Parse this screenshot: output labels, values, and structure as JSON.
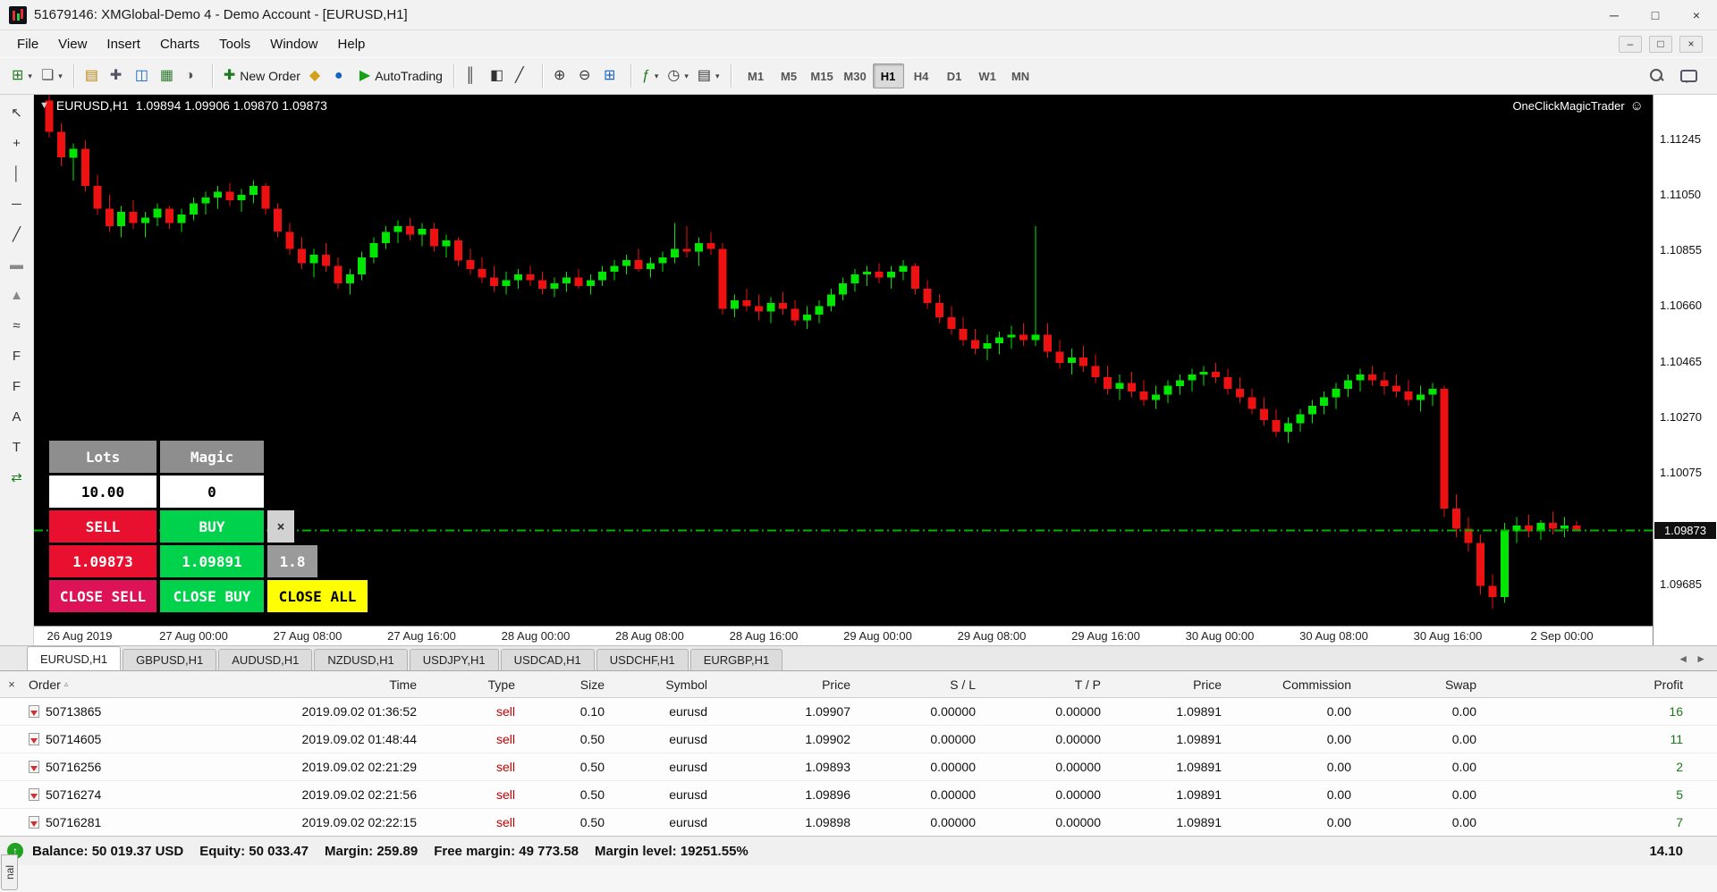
{
  "window": {
    "title": "51679146: XMGlobal-Demo 4 - Demo Account - [EURUSD,H1]",
    "controls": {
      "minimize": "─",
      "restore": "□",
      "close": "×"
    }
  },
  "menu": {
    "items": [
      "File",
      "View",
      "Insert",
      "Charts",
      "Tools",
      "Window",
      "Help"
    ],
    "mdi_controls": {
      "minimize": "–",
      "restore": "□",
      "close": "×"
    }
  },
  "toolbar": {
    "groups": [
      {
        "buttons": [
          {
            "name": "new-chart",
            "glyph": "⊞",
            "color": "#1b7a1b",
            "caret": true
          },
          {
            "name": "profiles",
            "glyph": "❏",
            "color": "#555",
            "caret": true
          }
        ]
      },
      {
        "buttons": [
          {
            "name": "market-watch",
            "glyph": "▤",
            "color": "#b8860b"
          },
          {
            "name": "data-window",
            "glyph": "✚",
            "color": "#556"
          },
          {
            "name": "navigator",
            "glyph": "◫",
            "color": "#1565c0"
          },
          {
            "name": "terminal-toggle",
            "glyph": "▦",
            "color": "#2e7d32"
          },
          {
            "name": "strategy-tester",
            "glyph": "◑",
            "color": "#555"
          }
        ]
      },
      {
        "buttons": [
          {
            "name": "new-order",
            "glyph": "✚",
            "color": "#1b7a1b",
            "label": "New Order"
          },
          {
            "name": "metaeditor",
            "glyph": "◆",
            "color": "#d4a017"
          },
          {
            "name": "mql5-community",
            "glyph": "●",
            "color": "#1565c0"
          },
          {
            "name": "autotrading",
            "glyph": "▶",
            "color": "#18a018",
            "label": "AutoTrading"
          }
        ]
      },
      {
        "buttons": [
          {
            "name": "bar-chart-mode",
            "glyph": "║",
            "color": "#333"
          },
          {
            "name": "candlestick-mode",
            "glyph": "◧",
            "color": "#333"
          },
          {
            "name": "line-chart-mode",
            "glyph": "╱",
            "color": "#333"
          }
        ]
      },
      {
        "buttons": [
          {
            "name": "zoom-in",
            "glyph": "⊕",
            "color": "#333"
          },
          {
            "name": "zoom-out",
            "glyph": "⊖",
            "color": "#333"
          },
          {
            "name": "tile-windows",
            "glyph": "⊞",
            "color": "#1565c0"
          }
        ]
      },
      {
        "buttons": [
          {
            "name": "indicators",
            "glyph": "ƒ",
            "color": "#1b7a1b",
            "caret": true
          },
          {
            "name": "periods",
            "glyph": "◷",
            "color": "#333",
            "caret": true
          },
          {
            "name": "templates",
            "glyph": "▤",
            "color": "#333",
            "caret": true
          }
        ]
      }
    ],
    "timeframes": [
      "M1",
      "M5",
      "M15",
      "M30",
      "H1",
      "H4",
      "D1",
      "W1",
      "MN"
    ],
    "active_timeframe": "H1"
  },
  "left_tools": [
    {
      "name": "cursor-tool",
      "glyph": "↖"
    },
    {
      "name": "crosshair-tool",
      "glyph": "+"
    },
    {
      "name": "vertical-line-tool",
      "glyph": "│"
    },
    {
      "name": "horizontal-line-tool",
      "glyph": "─"
    },
    {
      "name": "trendline-tool",
      "glyph": "╱"
    },
    {
      "name": "rectangle-tool",
      "glyph": "▬",
      "color": "#8a8a8a"
    },
    {
      "name": "triangle-tool",
      "glyph": "▲",
      "color": "#8a8a8a"
    },
    {
      "name": "fibonacci-tool",
      "glyph": "≈"
    },
    {
      "name": "channel-tool",
      "glyph": "F"
    },
    {
      "name": "fibo-expansion-tool",
      "glyph": "F"
    },
    {
      "name": "text-tool",
      "glyph": "A"
    },
    {
      "name": "label-tool",
      "glyph": "T"
    },
    {
      "name": "arrows-tool",
      "glyph": "⇄",
      "color": "#1b7a1b"
    }
  ],
  "chart": {
    "oneclick_toggle": "▼",
    "symbol_label": "EURUSD,H1",
    "ohlc_line": "1.09894 1.09906 1.09870 1.09873",
    "overlay_label": "OneClickMagicTrader",
    "overlay_smiley": "☺",
    "price_scale": [
      "1.11245",
      "1.11050",
      "1.10855",
      "1.10660",
      "1.10465",
      "1.10270",
      "1.10075",
      "1.09685"
    ],
    "current_price": "1.09873",
    "time_labels": [
      "26 Aug 2019",
      "27 Aug 00:00",
      "27 Aug 08:00",
      "27 Aug 16:00",
      "28 Aug 00:00",
      "28 Aug 08:00",
      "28 Aug 16:00",
      "29 Aug 00:00",
      "29 Aug 08:00",
      "29 Aug 16:00",
      "30 Aug 00:00",
      "30 Aug 08:00",
      "30 Aug 16:00",
      "2 Sep 00:00"
    ]
  },
  "colors": {
    "bull": "#00e600",
    "bear": "#ee1111",
    "price_line": "#00b400",
    "badge_bg": "#101010",
    "panel_header_gray": "#8e8e8e",
    "panel_red": "#e8102e",
    "panel_green": "#00d24b",
    "panel_crimson": "#de1256",
    "panel_yellow": "#ffff00",
    "panel_gray": "#9a9a9a",
    "profit_green": "#1a7a1a",
    "sell_red": "#c00000"
  },
  "trade_panel": {
    "lots_label": "Lots",
    "magic_label": "Magic",
    "lots_value": "10.00",
    "magic_value": "0",
    "sell_label": "SELL",
    "buy_label": "BUY",
    "close_x": "×",
    "sell_price": "1.09873",
    "buy_price": "1.09891",
    "spread": "1.8",
    "close_sell_label": "CLOSE SELL",
    "close_buy_label": "CLOSE BUY",
    "close_all_label": "CLOSE ALL"
  },
  "chart_data": {
    "type": "candlestick",
    "symbol": "EURUSD",
    "timeframe": "H1",
    "ylim": [
      1.0954,
      1.114
    ],
    "current_price": 1.09873,
    "ohlc": [
      [
        1.1138,
        1.114,
        1.1125,
        1.1127
      ],
      [
        1.1127,
        1.113,
        1.1115,
        1.1118
      ],
      [
        1.1118,
        1.1123,
        1.111,
        1.1121
      ],
      [
        1.1121,
        1.1124,
        1.1106,
        1.1108
      ],
      [
        1.1108,
        1.1112,
        1.1098,
        1.11
      ],
      [
        1.11,
        1.1105,
        1.1092,
        1.1094
      ],
      [
        1.1094,
        1.1101,
        1.109,
        1.1099
      ],
      [
        1.1099,
        1.1103,
        1.1093,
        1.1095
      ],
      [
        1.1095,
        1.1099,
        1.109,
        1.1097
      ],
      [
        1.1097,
        1.1102,
        1.1094,
        1.11
      ],
      [
        1.11,
        1.1101,
        1.1093,
        1.1095
      ],
      [
        1.1095,
        1.11,
        1.1092,
        1.1098
      ],
      [
        1.1098,
        1.1104,
        1.1096,
        1.1102
      ],
      [
        1.1102,
        1.1106,
        1.1098,
        1.1104
      ],
      [
        1.1104,
        1.1108,
        1.11,
        1.1106
      ],
      [
        1.1106,
        1.1109,
        1.1101,
        1.1103
      ],
      [
        1.1103,
        1.1107,
        1.1099,
        1.1105
      ],
      [
        1.1105,
        1.111,
        1.1102,
        1.1108
      ],
      [
        1.1108,
        1.1109,
        1.1098,
        1.11
      ],
      [
        1.11,
        1.1102,
        1.109,
        1.1092
      ],
      [
        1.1092,
        1.1095,
        1.1084,
        1.1086
      ],
      [
        1.1086,
        1.109,
        1.1079,
        1.1081
      ],
      [
        1.1081,
        1.1086,
        1.1076,
        1.1084
      ],
      [
        1.1084,
        1.1088,
        1.1078,
        1.108
      ],
      [
        1.108,
        1.1083,
        1.1072,
        1.1074
      ],
      [
        1.1074,
        1.1079,
        1.107,
        1.1077
      ],
      [
        1.1077,
        1.1085,
        1.1075,
        1.1083
      ],
      [
        1.1083,
        1.109,
        1.1081,
        1.1088
      ],
      [
        1.1088,
        1.1094,
        1.1086,
        1.1092
      ],
      [
        1.1092,
        1.1096,
        1.1088,
        1.1094
      ],
      [
        1.1094,
        1.1097,
        1.1089,
        1.1091
      ],
      [
        1.1091,
        1.1095,
        1.1087,
        1.1093
      ],
      [
        1.1093,
        1.1095,
        1.1085,
        1.1087
      ],
      [
        1.1087,
        1.1091,
        1.1083,
        1.1089
      ],
      [
        1.1089,
        1.109,
        1.108,
        1.1082
      ],
      [
        1.1082,
        1.1086,
        1.1077,
        1.1079
      ],
      [
        1.1079,
        1.1083,
        1.1074,
        1.1076
      ],
      [
        1.1076,
        1.108,
        1.1071,
        1.1073
      ],
      [
        1.1073,
        1.1078,
        1.107,
        1.1075
      ],
      [
        1.1075,
        1.1079,
        1.1072,
        1.1077
      ],
      [
        1.1077,
        1.108,
        1.1073,
        1.1075
      ],
      [
        1.1075,
        1.1078,
        1.107,
        1.1072
      ],
      [
        1.1072,
        1.1076,
        1.1069,
        1.1074
      ],
      [
        1.1074,
        1.1078,
        1.1071,
        1.1076
      ],
      [
        1.1076,
        1.1079,
        1.1072,
        1.1073
      ],
      [
        1.1073,
        1.1077,
        1.107,
        1.1075
      ],
      [
        1.1075,
        1.108,
        1.1073,
        1.1078
      ],
      [
        1.1078,
        1.1082,
        1.1075,
        1.108
      ],
      [
        1.108,
        1.1084,
        1.1077,
        1.1082
      ],
      [
        1.1082,
        1.1086,
        1.1078,
        1.1079
      ],
      [
        1.1079,
        1.1083,
        1.1076,
        1.1081
      ],
      [
        1.1081,
        1.1085,
        1.1078,
        1.1083
      ],
      [
        1.1083,
        1.1095,
        1.1081,
        1.1086
      ],
      [
        1.1086,
        1.1094,
        1.1083,
        1.1085
      ],
      [
        1.1085,
        1.109,
        1.108,
        1.1088
      ],
      [
        1.1088,
        1.1092,
        1.1084,
        1.1086
      ],
      [
        1.1086,
        1.1088,
        1.1063,
        1.1065
      ],
      [
        1.1065,
        1.107,
        1.1062,
        1.1068
      ],
      [
        1.1068,
        1.1072,
        1.1064,
        1.1066
      ],
      [
        1.1066,
        1.107,
        1.1061,
        1.1064
      ],
      [
        1.1064,
        1.1069,
        1.106,
        1.1067
      ],
      [
        1.1067,
        1.1071,
        1.1063,
        1.1065
      ],
      [
        1.1065,
        1.1068,
        1.1059,
        1.1061
      ],
      [
        1.1061,
        1.1066,
        1.1058,
        1.1063
      ],
      [
        1.1063,
        1.1068,
        1.106,
        1.1066
      ],
      [
        1.1066,
        1.1072,
        1.1064,
        1.107
      ],
      [
        1.107,
        1.1076,
        1.1068,
        1.1074
      ],
      [
        1.1074,
        1.1079,
        1.1071,
        1.1077
      ],
      [
        1.1077,
        1.108,
        1.1073,
        1.1078
      ],
      [
        1.1078,
        1.1081,
        1.1074,
        1.1076
      ],
      [
        1.1076,
        1.108,
        1.1072,
        1.1078
      ],
      [
        1.1078,
        1.1082,
        1.1075,
        1.108
      ],
      [
        1.108,
        1.1081,
        1.107,
        1.1072
      ],
      [
        1.1072,
        1.1075,
        1.1065,
        1.1067
      ],
      [
        1.1067,
        1.107,
        1.106,
        1.1062
      ],
      [
        1.1062,
        1.1066,
        1.1056,
        1.1058
      ],
      [
        1.1058,
        1.1062,
        1.1052,
        1.1054
      ],
      [
        1.1054,
        1.1058,
        1.1049,
        1.1051
      ],
      [
        1.1051,
        1.1056,
        1.1047,
        1.1053
      ],
      [
        1.1053,
        1.1057,
        1.1049,
        1.1055
      ],
      [
        1.1055,
        1.1059,
        1.1051,
        1.1056
      ],
      [
        1.1056,
        1.106,
        1.1052,
        1.1054
      ],
      [
        1.1054,
        1.1094,
        1.1052,
        1.1056
      ],
      [
        1.1056,
        1.106,
        1.1048,
        1.105
      ],
      [
        1.105,
        1.1054,
        1.1044,
        1.1046
      ],
      [
        1.1046,
        1.1051,
        1.1042,
        1.1048
      ],
      [
        1.1048,
        1.1052,
        1.1043,
        1.1045
      ],
      [
        1.1045,
        1.1049,
        1.1039,
        1.1041
      ],
      [
        1.1041,
        1.1045,
        1.1035,
        1.1037
      ],
      [
        1.1037,
        1.1042,
        1.1033,
        1.1039
      ],
      [
        1.1039,
        1.1043,
        1.1034,
        1.1036
      ],
      [
        1.1036,
        1.104,
        1.1031,
        1.1033
      ],
      [
        1.1033,
        1.1038,
        1.103,
        1.1035
      ],
      [
        1.1035,
        1.104,
        1.1032,
        1.1038
      ],
      [
        1.1038,
        1.1042,
        1.1035,
        1.104
      ],
      [
        1.104,
        1.1044,
        1.1036,
        1.1042
      ],
      [
        1.1042,
        1.1045,
        1.1038,
        1.1043
      ],
      [
        1.1043,
        1.1046,
        1.1039,
        1.1041
      ],
      [
        1.1041,
        1.1044,
        1.1035,
        1.1037
      ],
      [
        1.1037,
        1.1041,
        1.1032,
        1.1034
      ],
      [
        1.1034,
        1.1037,
        1.1028,
        1.103
      ],
      [
        1.103,
        1.1034,
        1.1024,
        1.1026
      ],
      [
        1.1026,
        1.103,
        1.102,
        1.1022
      ],
      [
        1.1022,
        1.1027,
        1.1018,
        1.1025
      ],
      [
        1.1025,
        1.103,
        1.1022,
        1.1028
      ],
      [
        1.1028,
        1.1033,
        1.1025,
        1.1031
      ],
      [
        1.1031,
        1.1036,
        1.1028,
        1.1034
      ],
      [
        1.1034,
        1.1039,
        1.103,
        1.1037
      ],
      [
        1.1037,
        1.1042,
        1.1034,
        1.104
      ],
      [
        1.104,
        1.1044,
        1.1036,
        1.1042
      ],
      [
        1.1042,
        1.1045,
        1.1038,
        1.104
      ],
      [
        1.104,
        1.1043,
        1.1035,
        1.1038
      ],
      [
        1.1038,
        1.1042,
        1.1034,
        1.1036
      ],
      [
        1.1036,
        1.104,
        1.1031,
        1.1033
      ],
      [
        1.1033,
        1.1038,
        1.1029,
        1.1035
      ],
      [
        1.1035,
        1.1039,
        1.1031,
        1.1037
      ],
      [
        1.1037,
        1.1038,
        1.0992,
        1.0995
      ],
      [
        1.0995,
        1.1,
        1.0985,
        1.0988
      ],
      [
        1.0988,
        1.0992,
        1.098,
        1.0983
      ],
      [
        1.0983,
        1.0986,
        1.0965,
        1.0968
      ],
      [
        1.0968,
        1.0972,
        1.096,
        1.0964
      ],
      [
        1.0964,
        1.099,
        1.0962,
        1.0987
      ],
      [
        1.0987,
        1.0992,
        1.0983,
        1.0989
      ],
      [
        1.0989,
        1.0993,
        1.0985,
        1.0987
      ],
      [
        1.0987,
        1.0991,
        1.0984,
        1.099
      ],
      [
        1.099,
        1.0994,
        1.0986,
        1.0988
      ],
      [
        1.0988,
        1.0992,
        1.0985,
        1.0989
      ],
      [
        1.0989,
        1.09906,
        1.0987,
        1.09873
      ]
    ]
  },
  "tabs": {
    "items": [
      "EURUSD,H1",
      "GBPUSD,H1",
      "AUDUSD,H1",
      "NZDUSD,H1",
      "USDJPY,H1",
      "USDCAD,H1",
      "USDCHF,H1",
      "EURGBP,H1"
    ],
    "active": "EURUSD,H1",
    "scroll_left": "◄",
    "scroll_right": "►"
  },
  "terminal": {
    "close_x": "×",
    "sort_indicator": "▵",
    "columns": [
      "Order",
      "Time",
      "Type",
      "Size",
      "Symbol",
      "Price",
      "S / L",
      "T / P",
      "Price",
      "Commission",
      "Swap",
      "Profit"
    ],
    "rows": [
      [
        "50713865",
        "2019.09.02 01:36:52",
        "sell",
        "0.10",
        "eurusd",
        "1.09907",
        "0.00000",
        "0.00000",
        "1.09891",
        "0.00",
        "0.00",
        "16"
      ],
      [
        "50714605",
        "2019.09.02 01:48:44",
        "sell",
        "0.50",
        "eurusd",
        "1.09902",
        "0.00000",
        "0.00000",
        "1.09891",
        "0.00",
        "0.00",
        "11"
      ],
      [
        "50716256",
        "2019.09.02 02:21:29",
        "sell",
        "0.50",
        "eurusd",
        "1.09893",
        "0.00000",
        "0.00000",
        "1.09891",
        "0.00",
        "0.00",
        "2"
      ],
      [
        "50716274",
        "2019.09.02 02:21:56",
        "sell",
        "0.50",
        "eurusd",
        "1.09896",
        "0.00000",
        "0.00000",
        "1.09891",
        "0.00",
        "0.00",
        "5"
      ],
      [
        "50716281",
        "2019.09.02 02:22:15",
        "sell",
        "0.50",
        "eurusd",
        "1.09898",
        "0.00000",
        "0.00000",
        "1.09891",
        "0.00",
        "0.00",
        "7"
      ]
    ],
    "balance_segments": [
      "Balance: 50 019.37 USD",
      "Equity: 50 033.47",
      "Margin: 259.89",
      "Free margin: 49 773.58",
      "Margin level: 19251.55%"
    ],
    "balance_profit": "14.10",
    "side_tab": "nal"
  }
}
